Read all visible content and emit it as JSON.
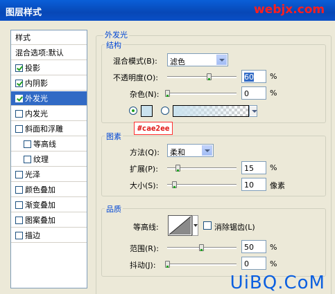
{
  "window": {
    "title": "图层样式",
    "watermark": "webjx.com"
  },
  "sidebar": {
    "items": [
      {
        "label": "样式",
        "checkbox": false,
        "checked": false
      },
      {
        "label": "混合选项:默认",
        "checkbox": false,
        "checked": false
      },
      {
        "label": "投影",
        "checkbox": true,
        "checked": true
      },
      {
        "label": "内阴影",
        "checkbox": true,
        "checked": true
      },
      {
        "label": "外发光",
        "checkbox": true,
        "checked": true,
        "selected": true
      },
      {
        "label": "内发光",
        "checkbox": true,
        "checked": false
      },
      {
        "label": "斜面和浮雕",
        "checkbox": true,
        "checked": false
      },
      {
        "label": "等高线",
        "checkbox": true,
        "checked": false,
        "indent": true
      },
      {
        "label": "纹理",
        "checkbox": true,
        "checked": false,
        "indent": true
      },
      {
        "label": "光泽",
        "checkbox": true,
        "checked": false
      },
      {
        "label": "颜色叠加",
        "checkbox": true,
        "checked": false
      },
      {
        "label": "渐变叠加",
        "checkbox": true,
        "checked": false
      },
      {
        "label": "图案叠加",
        "checkbox": true,
        "checked": false
      },
      {
        "label": "描边",
        "checkbox": true,
        "checked": false
      }
    ]
  },
  "panel": {
    "title": "外发光",
    "structure": {
      "label": "结构",
      "blend_mode_label": "混合模式(B):",
      "blend_mode_value": "滤色",
      "opacity_label": "不透明度(O):",
      "opacity_value": "60",
      "opacity_unit": "%",
      "noise_label": "杂色(N):",
      "noise_value": "0",
      "noise_unit": "%",
      "color_hex": "#cae2ee"
    },
    "elements": {
      "label": "图素",
      "technique_label": "方法(Q):",
      "technique_value": "柔和",
      "spread_label": "扩展(P):",
      "spread_value": "15",
      "spread_unit": "%",
      "size_label": "大小(S):",
      "size_value": "10",
      "size_unit": "像素"
    },
    "quality": {
      "label": "品质",
      "contour_label": "等高线:",
      "antialias_label": "消除锯齿(L)",
      "range_label": "范围(R):",
      "range_value": "50",
      "range_unit": "%",
      "jitter_label": "抖动(J):",
      "jitter_value": "0",
      "jitter_unit": "%"
    }
  },
  "tooltip": {
    "text": "#cae2ee"
  },
  "logo": {
    "text": "UiBQ.CoM"
  },
  "colors": {
    "title_blue": "#0747b6",
    "selection": "#316ac5",
    "group_label": "#0046d5",
    "glow": "#cae2ee"
  }
}
